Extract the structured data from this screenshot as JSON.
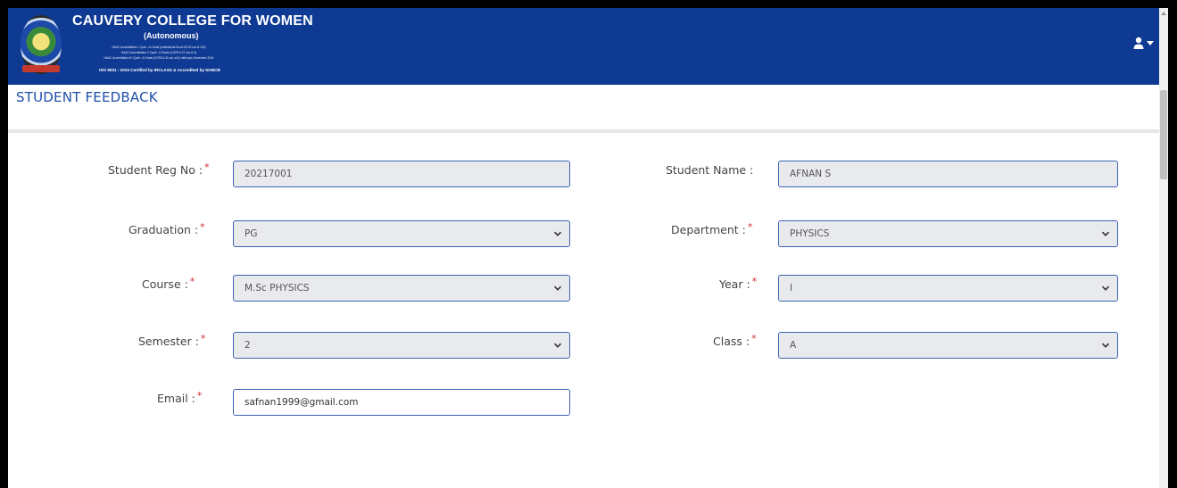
{
  "header": {
    "college_name": "CAUVERY COLLEGE FOR WOMEN",
    "college_sub": "(Autonomous)",
    "accreditation_lines": [
      "NAAC Accreditation I Cycle : A Grade (Institutional Score 83.00 out of 100)",
      "NAAC Accreditation II Cycle : A Grade (CGPA 3.27 out of 4)",
      "NAAC Accreditation III Cycle : A Grade (CGPA 3.41 out of 4) valid upto December 2024"
    ],
    "iso_line": "ISO 9001 : 2015 Certified by IRCLASS & Accredited by NABCB",
    "background_color": "#0f3a94",
    "user_icon": "user-icon",
    "dropdown_icon": "caret-down-icon"
  },
  "page": {
    "title": "STUDENT FEEDBACK"
  },
  "form": {
    "reg_no": {
      "label": "Student Reg No :",
      "value": "20217001"
    },
    "student_name": {
      "label": "Student Name :",
      "value": "AFNAN S"
    },
    "graduation": {
      "label": "Graduation :",
      "value": "PG"
    },
    "department": {
      "label": "Department :",
      "value": "PHYSICS"
    },
    "course": {
      "label": "Course :",
      "value": "M.Sc PHYSICS"
    },
    "year": {
      "label": "Year :",
      "value": "I"
    },
    "semester": {
      "label": "Semester :",
      "value": "2"
    },
    "class": {
      "label": "Class :",
      "value": "A"
    },
    "email": {
      "label": "Email :",
      "value": "safnan1999@gmail.com"
    },
    "required_mark": "*",
    "required_color": "#d32f2f",
    "field_border_color": "#3d63b3"
  }
}
